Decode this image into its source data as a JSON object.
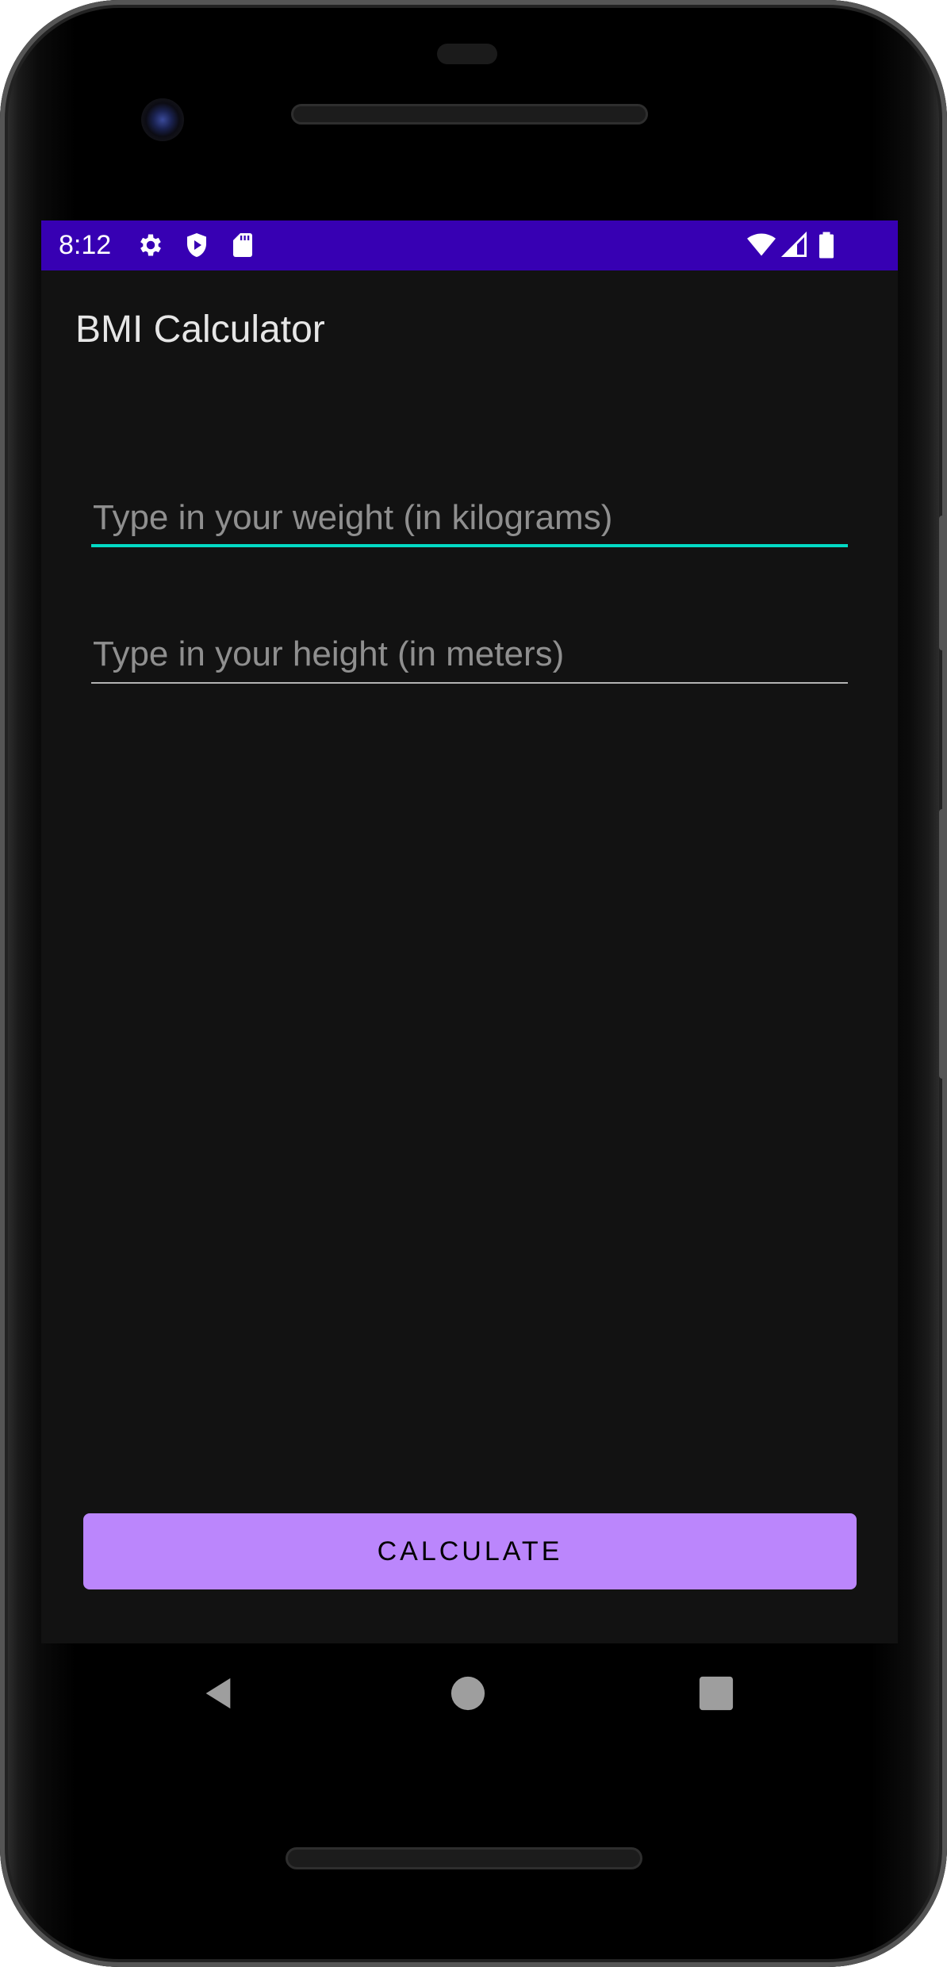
{
  "status_bar": {
    "time": "8:12",
    "icons_left": [
      "gear-icon",
      "shield-play-icon",
      "sd-card-icon"
    ],
    "icons_right": [
      "wifi-icon",
      "cell-signal-icon",
      "battery-icon"
    ],
    "background_color": "#3700b3"
  },
  "app": {
    "title": "BMI Calculator",
    "background_color": "#121212"
  },
  "form": {
    "weight": {
      "placeholder": "Type in your weight (in kilograms)",
      "value": "",
      "focused": true,
      "underline_color": "#03dac5"
    },
    "height": {
      "placeholder": "Type in your height (in meters)",
      "value": "",
      "focused": false,
      "underline_color": "#b3b3b3"
    }
  },
  "actions": {
    "calculate_label": "CALCULATE",
    "button_color": "#bb86fc"
  },
  "navigation": {
    "buttons": [
      "back-icon",
      "home-icon",
      "recents-icon"
    ]
  }
}
